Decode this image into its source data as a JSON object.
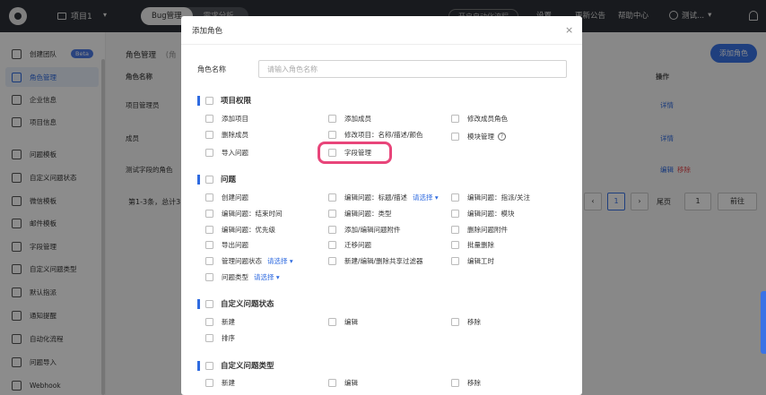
{
  "topbar": {
    "project_name": "项目1",
    "tabs": [
      {
        "label": "Bug管理",
        "active": true
      },
      {
        "label": "需求分析",
        "active": false
      }
    ],
    "open_automation": "开启自动化流程",
    "settings": "设置",
    "announcements": "更新公告",
    "help": "帮助中心",
    "user_name": "测试..."
  },
  "sidebar": {
    "items": [
      {
        "label": "创建团队",
        "badge": "Beta",
        "icon": "team-icon"
      },
      {
        "label": "角色管理",
        "active": true,
        "icon": "role-icon"
      },
      {
        "label": "企业信息",
        "icon": "building-icon"
      },
      {
        "label": "项目信息",
        "icon": "project-icon"
      },
      {
        "label": "问题模板",
        "icon": "template-icon"
      },
      {
        "label": "自定义问题状态",
        "icon": "status-icon"
      },
      {
        "label": "微信模板",
        "icon": "wechat-icon"
      },
      {
        "label": "邮件模板",
        "icon": "mail-icon"
      },
      {
        "label": "字段管理",
        "icon": "field-icon"
      },
      {
        "label": "自定义问题类型",
        "icon": "grid-icon"
      },
      {
        "label": "默认指派",
        "icon": "assign-icon"
      },
      {
        "label": "通知提醒",
        "icon": "bell-icon"
      },
      {
        "label": "自动化流程",
        "icon": "flow-icon"
      },
      {
        "label": "问题导入",
        "icon": "import-icon"
      },
      {
        "label": "Webhook",
        "icon": "webhook-icon"
      }
    ]
  },
  "main": {
    "title": "角色管理",
    "title_extra": "(角",
    "add_role": "添加角色",
    "col_name": "角色名称",
    "col_action": "操作",
    "rows": [
      {
        "name": "项目管理员",
        "action": "详情"
      },
      {
        "name": "成员",
        "action": "详情"
      },
      {
        "name": "测试字段的角色",
        "action": "编辑",
        "delete": "移除"
      }
    ],
    "footer": "第1-3条，总计3",
    "pagination": {
      "current": "1",
      "last": "尾页",
      "goto_value": "1",
      "goto": "前往"
    }
  },
  "modal": {
    "title": "添加角色",
    "close": "×",
    "name_label": "角色名称",
    "name_placeholder": "请输入角色名称",
    "sections": [
      {
        "title": "项目权限",
        "items": [
          {
            "label": "添加项目"
          },
          {
            "label": "添加成员"
          },
          {
            "label": "修改成员角色"
          },
          {
            "label": "删除成员"
          },
          {
            "label": "修改项目：名称/描述/颜色"
          },
          {
            "label": "模块管理",
            "help": "?"
          },
          {
            "label": "导入问题"
          },
          {
            "label": "字段管理",
            "highlighted": true
          }
        ]
      },
      {
        "title": "问题",
        "items": [
          {
            "label": "创建问题"
          },
          {
            "label": "编辑问题：标题/描述",
            "select": "请选择"
          },
          {
            "label": "编辑问题：指派/关注"
          },
          {
            "label": "编辑问题：结束时间"
          },
          {
            "label": "编辑问题：类型"
          },
          {
            "label": "编辑问题：模块"
          },
          {
            "label": "编辑问题：优先级"
          },
          {
            "label": "添加/编辑问题附件"
          },
          {
            "label": "删除问题附件"
          },
          {
            "label": "导出问题"
          },
          {
            "label": "迁移问题"
          },
          {
            "label": "批量删除"
          },
          {
            "label": "管理问题状态",
            "select": "请选择"
          },
          {
            "label": "新建/编辑/删除共享过滤器"
          },
          {
            "label": "编辑工时"
          },
          {
            "label": "问题类型",
            "select": "请选择"
          }
        ]
      },
      {
        "title": "自定义问题状态",
        "items": [
          {
            "label": "新建"
          },
          {
            "label": "编辑"
          },
          {
            "label": "移除"
          },
          {
            "label": "排序"
          }
        ]
      },
      {
        "title": "自定义问题类型",
        "items": [
          {
            "label": "新建"
          },
          {
            "label": "编辑"
          },
          {
            "label": "移除"
          }
        ]
      }
    ]
  },
  "colors": {
    "accent": "#2f6be0",
    "topbar": "#2d3037",
    "highlight": "#e8457a",
    "danger": "#e5484d"
  }
}
